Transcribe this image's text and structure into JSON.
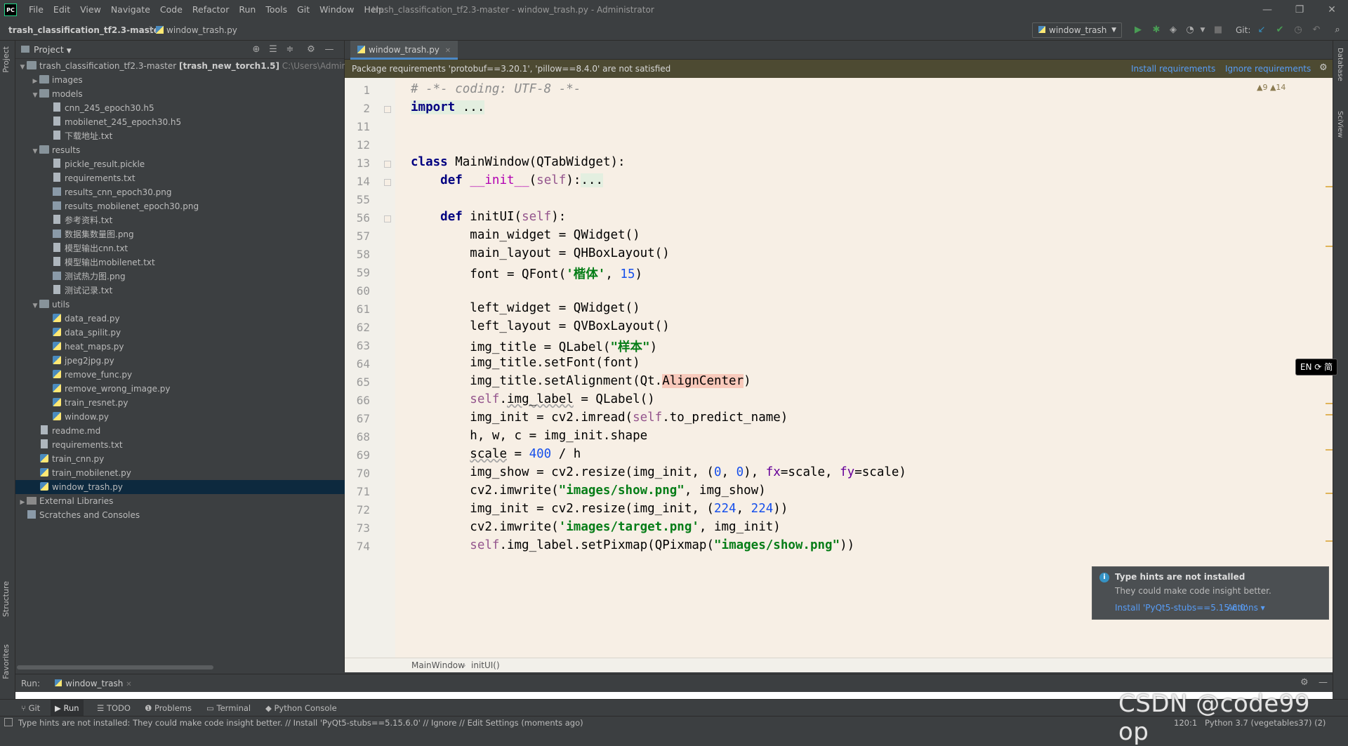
{
  "app": {
    "logo": "PC",
    "menus": [
      "File",
      "Edit",
      "View",
      "Navigate",
      "Code",
      "Refactor",
      "Run",
      "Tools",
      "Git",
      "Window",
      "Help"
    ],
    "window_title": "trash_classification_tf2.3-master - window_trash.py - Administrator"
  },
  "navbar": {
    "project": "trash_classification_tf2.3-master",
    "file": "window_trash.py",
    "run_config": "window_trash",
    "git_label": "Git:"
  },
  "stripes": {
    "left": [
      "Project",
      "Structure",
      "Favorites"
    ],
    "right": [
      "Database",
      "SciView"
    ]
  },
  "project_panel": {
    "title": "Project",
    "root_name": "trash_classification_tf2.3-master",
    "root_tag": "[trash_new_torch1.5]",
    "root_path": "C:\\Users\\Administr",
    "tree": [
      {
        "label": "images",
        "type": "folder",
        "depth": 1,
        "arrow": "right"
      },
      {
        "label": "models",
        "type": "folder",
        "depth": 1,
        "arrow": "down"
      },
      {
        "label": "cnn_245_epoch30.h5",
        "type": "file",
        "depth": 2
      },
      {
        "label": "mobilenet_245_epoch30.h5",
        "type": "file",
        "depth": 2
      },
      {
        "label": "下载地址.txt",
        "type": "txt",
        "depth": 2
      },
      {
        "label": "results",
        "type": "folder",
        "depth": 1,
        "arrow": "down"
      },
      {
        "label": "pickle_result.pickle",
        "type": "file",
        "depth": 2
      },
      {
        "label": "requirements.txt",
        "type": "txt",
        "depth": 2
      },
      {
        "label": "results_cnn_epoch30.png",
        "type": "img",
        "depth": 2
      },
      {
        "label": "results_mobilenet_epoch30.png",
        "type": "img",
        "depth": 2
      },
      {
        "label": "参考资料.txt",
        "type": "txt",
        "depth": 2
      },
      {
        "label": "数据集数量图.png",
        "type": "img",
        "depth": 2
      },
      {
        "label": "模型输出cnn.txt",
        "type": "txt",
        "depth": 2
      },
      {
        "label": "模型输出mobilenet.txt",
        "type": "txt",
        "depth": 2
      },
      {
        "label": "测试热力图.png",
        "type": "img",
        "depth": 2
      },
      {
        "label": "测试记录.txt",
        "type": "txt",
        "depth": 2
      },
      {
        "label": "utils",
        "type": "folder",
        "depth": 1,
        "arrow": "down"
      },
      {
        "label": "data_read.py",
        "type": "py",
        "depth": 2
      },
      {
        "label": "data_spilit.py",
        "type": "py",
        "depth": 2
      },
      {
        "label": "heat_maps.py",
        "type": "py",
        "depth": 2
      },
      {
        "label": "jpeg2jpg.py",
        "type": "py",
        "depth": 2
      },
      {
        "label": "remove_func.py",
        "type": "py",
        "depth": 2
      },
      {
        "label": "remove_wrong_image.py",
        "type": "py",
        "depth": 2
      },
      {
        "label": "train_resnet.py",
        "type": "py",
        "depth": 2
      },
      {
        "label": "window.py",
        "type": "py",
        "depth": 2
      },
      {
        "label": "readme.md",
        "type": "file",
        "depth": 1
      },
      {
        "label": "requirements.txt",
        "type": "txt",
        "depth": 1
      },
      {
        "label": "train_cnn.py",
        "type": "py",
        "depth": 1
      },
      {
        "label": "train_mobilenet.py",
        "type": "py",
        "depth": 1
      },
      {
        "label": "window_trash.py",
        "type": "py",
        "depth": 1,
        "selected": true
      },
      {
        "label": "External Libraries",
        "type": "lib",
        "depth": 0,
        "arrow": "right"
      },
      {
        "label": "Scratches and Consoles",
        "type": "scratch",
        "depth": 0
      }
    ]
  },
  "editor": {
    "tab": "window_trash.py",
    "banner": "Package requirements 'protobuf==3.20.1', 'pillow==8.4.0' are not satisfied",
    "install_link": "Install requirements",
    "ignore_link": "Ignore requirements",
    "inspections": "▲9 ▲14",
    "line_numbers": [
      "1",
      "2",
      "11",
      "12",
      "13",
      "14",
      "55",
      "56",
      "57",
      "58",
      "59",
      "60",
      "61",
      "62",
      "63",
      "64",
      "65",
      "66",
      "67",
      "68",
      "69",
      "70",
      "71",
      "72",
      "73",
      "74"
    ],
    "breadcrumb": [
      "MainWindow",
      "initUI()"
    ]
  },
  "ime_badge": "EN ⟳ 简",
  "notification": {
    "title": "Type hints are not installed",
    "body": "They could make code insight better.",
    "link": "Install 'PyQt5-stubs==5.15.6.0'",
    "actions": "Actions ▾"
  },
  "run_panel": {
    "label": "Run:",
    "tab": "window_trash"
  },
  "tool_tabs": [
    "Git",
    "Run",
    "TODO",
    "Problems",
    "Terminal",
    "Python Console"
  ],
  "status": {
    "message": "Type hints are not installed: They could make code insight better. // Install 'PyQt5-stubs==5.15.6.0' // Ignore // Edit Settings (moments ago)",
    "position": "120:1",
    "interpreter": "Python 3.7 (vegetables37) (2)"
  },
  "watermark": "CSDN @code99 op"
}
